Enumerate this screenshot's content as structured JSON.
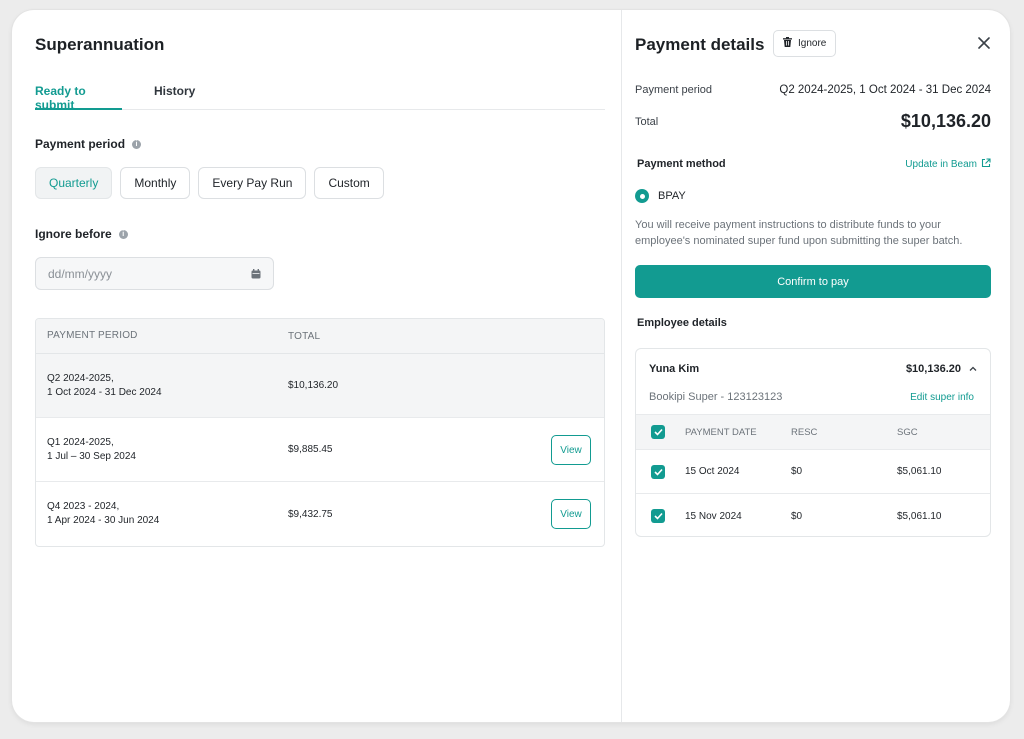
{
  "page": {
    "title": "Superannuation",
    "tabs": [
      {
        "label": "Ready to submit",
        "active": true
      },
      {
        "label": "History",
        "active": false
      }
    ],
    "payment_period": {
      "label": "Payment period",
      "options": [
        {
          "label": "Quarterly",
          "active": true
        },
        {
          "label": "Monthly",
          "active": false
        },
        {
          "label": "Every Pay Run",
          "active": false
        },
        {
          "label": "Custom",
          "active": false
        }
      ]
    },
    "ignore_before": {
      "label": "Ignore before",
      "placeholder": "dd/mm/yyyy",
      "value": ""
    },
    "periods_table": {
      "headers": [
        "PAYMENT PERIOD",
        "TOTAL"
      ],
      "rows": [
        {
          "period_line1": "Q2 2024-2025,",
          "period_line2": "1 Oct 2024 - 31 Dec 2024",
          "total": "$10,136.20",
          "selected": true,
          "action": ""
        },
        {
          "period_line1": "Q1 2024-2025,",
          "period_line2": "1 Jul – 30 Sep 2024",
          "total": "$9,885.45",
          "selected": false,
          "action": "View"
        },
        {
          "period_line1": "Q4 2023 - 2024,",
          "period_line2": "1 Apr 2024 - 30 Jun 2024",
          "total": "$9,432.75",
          "selected": false,
          "action": "View"
        }
      ]
    }
  },
  "details": {
    "title": "Payment details",
    "ignore_label": "Ignore",
    "payment_period_label": "Payment period",
    "payment_period_value": "Q2 2024-2025, 1 Oct 2024 - 31 Dec 2024",
    "total_label": "Total",
    "total_value": "$10,136.20",
    "payment_method_label": "Payment method",
    "update_link": "Update in Beam",
    "method": "BPAY",
    "method_description": "You will receive payment instructions to distribute funds to your employee's nominated super fund upon submitting the super batch.",
    "confirm_label": "Confirm to pay",
    "employee_details_label": "Employee details",
    "employee": {
      "name": "Yuna Kim",
      "total": "$10,136.20",
      "fund": "Bookipi Super - 123123123",
      "edit_link": "Edit super info",
      "headers": [
        "PAYMENT DATE",
        "RESC",
        "SGC"
      ],
      "rows": [
        {
          "date": "15 Oct 2024",
          "resc": "$0",
          "sgc": "$5,061.10",
          "checked": true
        },
        {
          "date": "15 Nov 2024",
          "resc": "$0",
          "sgc": "$5,061.10",
          "checked": true
        }
      ]
    }
  },
  "colors": {
    "accent": "#129b91",
    "muted_text": "#6c737a",
    "row_highlight": "#f4f5f6"
  },
  "icons": [
    "info-icon",
    "calendar-icon",
    "trash-icon",
    "close-icon",
    "external-link-icon",
    "chevron-up-icon",
    "check-icon"
  ]
}
